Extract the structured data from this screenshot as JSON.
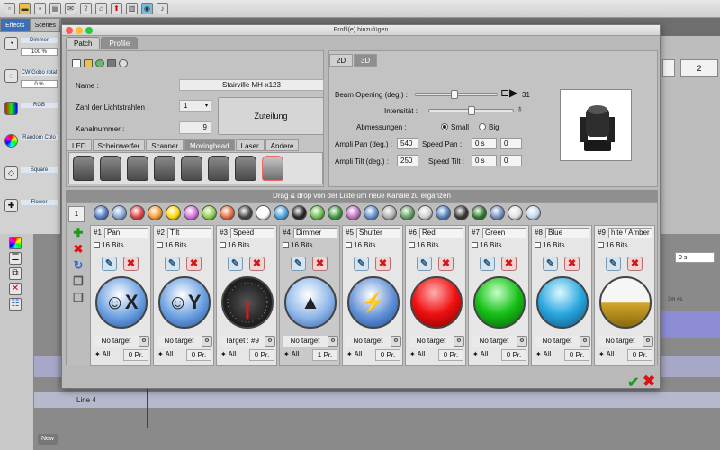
{
  "background": {
    "side_tabs": [
      "Effects",
      "Scenes"
    ],
    "side_items": [
      {
        "name": "Dimmer",
        "value": "100 %",
        "icon": "dimmer-icon"
      },
      {
        "name": "CW Gobo rotat",
        "value": "0 %",
        "icon": "gobo-icon"
      },
      {
        "name": "RGB",
        "value": "",
        "icon": "rgb-icon"
      },
      {
        "name": "Random Colo",
        "value": "",
        "icon": "color-wheel-icon"
      },
      {
        "name": "Square",
        "value": "",
        "icon": "square-icon"
      },
      {
        "name": "Flower",
        "value": "",
        "icon": "flower-icon"
      }
    ],
    "right_box_value": "2",
    "right_field_value": "0 s",
    "right_timestamp": "3m 4s",
    "lane_label": "Line 4",
    "new_tab": "New"
  },
  "dialog": {
    "title": "Profil(e) hinzufügen",
    "tabs": [
      "Patch",
      "Profile"
    ],
    "active_tab": 1,
    "name_label": "Name :",
    "name_value": "Stairville MH-x123",
    "beams_label": "Zahl der Lichtstrahlen :",
    "beams_value": "1",
    "channel_label": "Kanalnummer :",
    "channel_value": "9",
    "assign_button": "Zuteilung",
    "category_tabs": [
      "LED",
      "Scheinwerfer",
      "Scanner",
      "Movinghead",
      "Laser",
      "Andere"
    ],
    "active_category": 3,
    "view_tabs": [
      "2D",
      "3D"
    ],
    "active_view": 1,
    "beam_label": "Beam Opening (deg.) :",
    "beam_value": "31",
    "beam_slider": 0.45,
    "intensity_label": "Intensität :",
    "intensity_slider": 0.5,
    "size_label": "Abmessungen :",
    "size_small": "Small",
    "size_big": "Big",
    "ampli_pan_label": "Ampli Pan (deg.) :",
    "ampli_pan_value": "540",
    "speed_pan_label": "Speed Pan :",
    "speed_pan_value": "0 s",
    "speed_pan_extra": "0",
    "ampli_tilt_label": "Ampli Tilt (deg.) :",
    "ampli_tilt_value": "250",
    "speed_tilt_label": "Speed Tilt :",
    "speed_tilt_value": "0 s",
    "speed_tilt_extra": "0",
    "drag_hint": "Drag & drop von der Liste um neue Kanäle zu ergänzen",
    "page_number": "1"
  },
  "palette_colors": [
    "#4d7bc4",
    "#7fa7d8",
    "#e04040",
    "#ff9a30",
    "#ffd800",
    "#d76ce0",
    "#8fd04a",
    "#e96a3c",
    "#444",
    "#fff",
    "#4aa0e0",
    "#222",
    "#6bbf4a",
    "#3a9a3a",
    "#c070c0",
    "#6090d0",
    "#b0b0b0",
    "#60a060",
    "#d0d0d0",
    "#5080c0",
    "#333",
    "#2a7a2a",
    "#7090c0",
    "#e0e0e0",
    "#c0d8f0"
  ],
  "channels": [
    {
      "num": "#1",
      "name": "Pan",
      "bits": "16 Bits",
      "glyph": "☺X",
      "target": "No target",
      "all": "All",
      "pr": "0 Pr.",
      "orb": "radial-gradient(circle at 45% 35%,#ffffff,#6a9fe0 55%,#1d4f9a)",
      "icon": "pan-icon"
    },
    {
      "num": "#2",
      "name": "Tilt",
      "bits": "16 Bits",
      "glyph": "☺Y",
      "target": "No target",
      "all": "All",
      "pr": "0 Pr.",
      "orb": "radial-gradient(circle at 45% 35%,#ffffff,#6a9fe0 55%,#1d4f9a)",
      "icon": "tilt-icon"
    },
    {
      "num": "#3",
      "name": "Speed",
      "bits": "16 Bits",
      "glyph": "",
      "target": "Target : #9",
      "all": "All",
      "pr": "0 Pr.",
      "orb": "radial-gradient(circle,#555,#222 60%,#111)",
      "icon": "speed-gauge-icon"
    },
    {
      "num": "#4",
      "name": "Dimmer",
      "bits": "16 Bits",
      "glyph": "▲",
      "target": "No target",
      "all": "All",
      "pr": "1 Pr.",
      "orb": "radial-gradient(circle at 45% 35%,#ffffff,#8eb6e8 55%,#2b5ca8)",
      "icon": "dimmer-triangle-icon"
    },
    {
      "num": "#5",
      "name": "Shutter",
      "bits": "16 Bits",
      "glyph": "⚡",
      "target": "No target",
      "all": "All",
      "pr": "0 Pr.",
      "orb": "radial-gradient(circle at 45% 35%,#ffffff,#5f8fd4 55%,#1a4892)",
      "icon": "shutter-icon"
    },
    {
      "num": "#6",
      "name": "Red",
      "bits": "16 Bits",
      "glyph": "",
      "target": "No target",
      "all": "All",
      "pr": "0 Pr.",
      "orb": "radial-gradient(circle at 45% 30%,#ffb0b0,#f01010 50%,#7a0000)",
      "icon": "red-color-icon"
    },
    {
      "num": "#7",
      "name": "Green",
      "bits": "16 Bits",
      "glyph": "",
      "target": "No target",
      "all": "All",
      "pr": "0 Pr.",
      "orb": "radial-gradient(circle at 45% 30%,#c8ffc8,#16c016 50%,#0a5a0a)",
      "icon": "green-color-icon"
    },
    {
      "num": "#8",
      "name": "Blue",
      "bits": "16 Bits",
      "glyph": "",
      "target": "No target",
      "all": "All",
      "pr": "0 Pr.",
      "orb": "radial-gradient(circle at 45% 30%,#e0f8ff,#2aa8e0 50%,#0b4d7a)",
      "icon": "blue-color-icon"
    },
    {
      "num": "#9",
      "name": "hite / Amber",
      "bits": "16 Bits",
      "glyph": "",
      "target": "No target",
      "all": "All",
      "pr": "0 Pr.",
      "orb": "linear-gradient(#f6f6f6 0%,#f6f6f6 48%,#d0a52a 52%,#8a6a10 100%)",
      "icon": "white-amber-icon"
    }
  ]
}
